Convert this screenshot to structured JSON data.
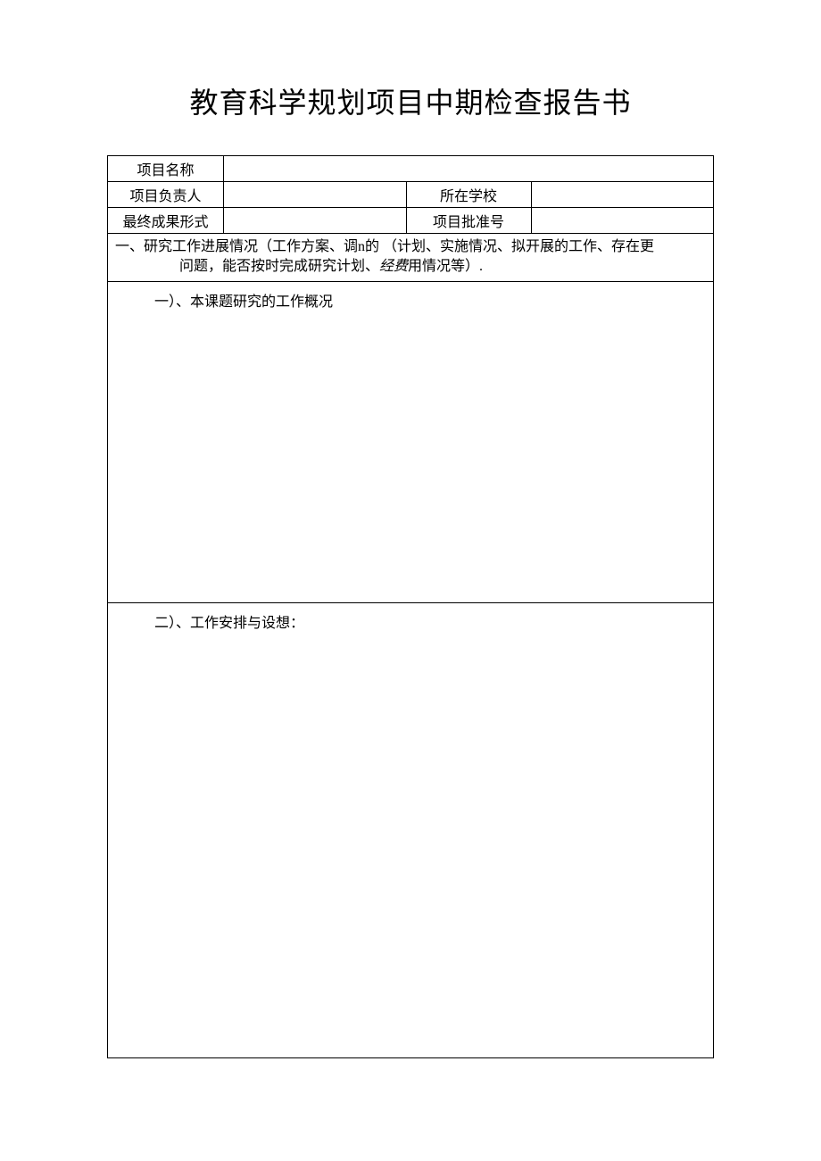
{
  "title": "教育科学规划项目中期检查报告书",
  "fields": {
    "project_name_label": "项目名称",
    "project_name_value": "",
    "project_leader_label": "项目负责人",
    "project_leader_value": "",
    "school_label": "所在学校",
    "school_value": "",
    "result_form_label": "最终成果形式",
    "result_form_value": "",
    "approval_no_label": "项目批准号",
    "approval_no_value": ""
  },
  "section1": {
    "header_part1": "一、研究工作进展情况（工作方案、调n的",
    "header_part2": "（计划、实施情况、拟开展的工作、存在更",
    "header_line2_prefix": "问题，能否按时完成研究计划、",
    "header_line2_italic": "经费",
    "header_line2_suffix": "用情况等）.",
    "sub1_label": "一）、本课题研究的工作概况",
    "sub2_label": "二）、工作安排与设想："
  }
}
